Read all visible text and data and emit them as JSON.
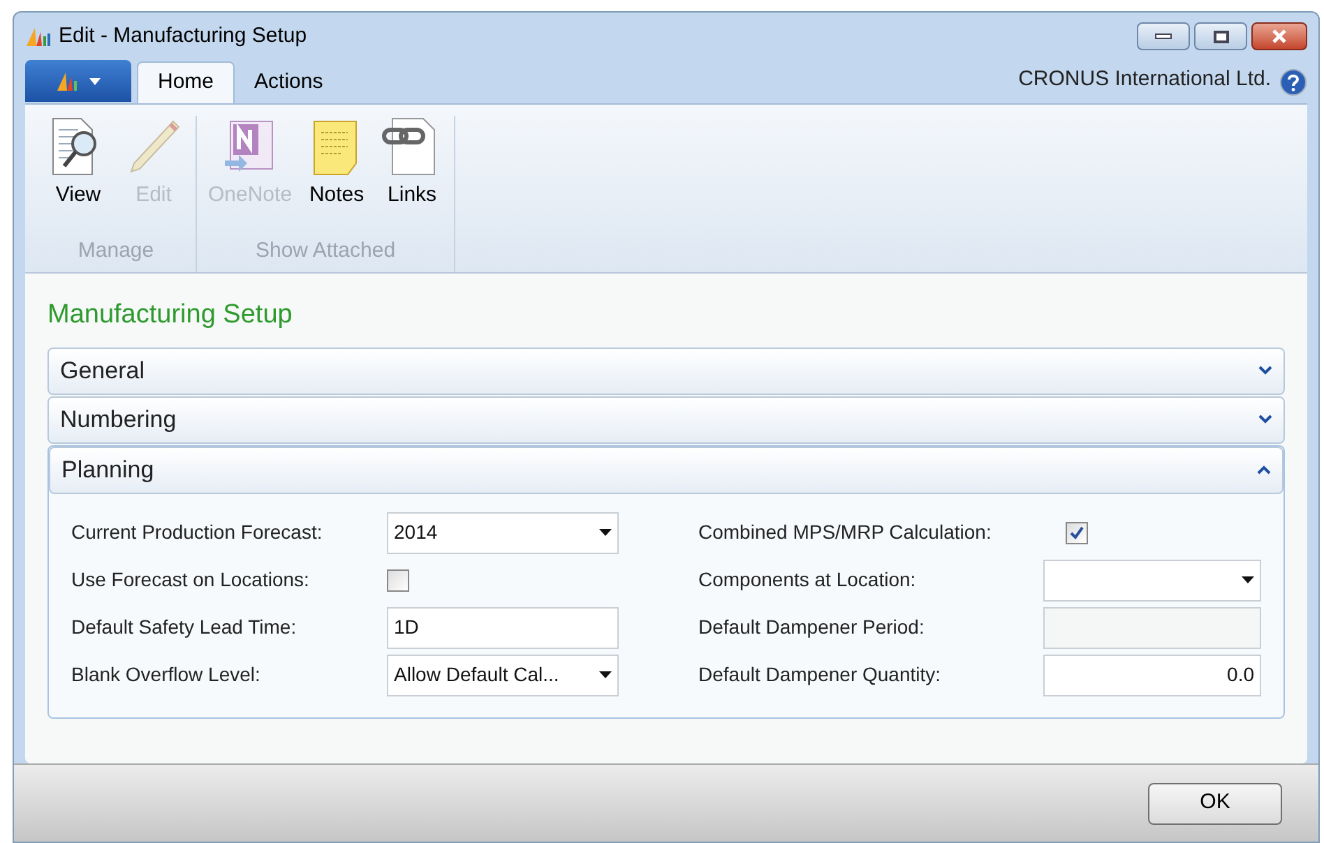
{
  "window": {
    "title": "Edit - Manufacturing Setup"
  },
  "ribbon": {
    "tabs": [
      {
        "label": "Home",
        "selected": true
      },
      {
        "label": "Actions",
        "selected": false
      }
    ],
    "company": "CRONUS International Ltd.",
    "groups": [
      {
        "label": "Manage",
        "buttons": [
          {
            "label": "View",
            "kind": "view",
            "disabled": false
          },
          {
            "label": "Edit",
            "kind": "edit",
            "disabled": true
          }
        ]
      },
      {
        "label": "Show Attached",
        "buttons": [
          {
            "label": "OneNote",
            "kind": "onenote",
            "disabled": true
          },
          {
            "label": "Notes",
            "kind": "notes",
            "disabled": false
          },
          {
            "label": "Links",
            "kind": "links",
            "disabled": false
          }
        ]
      }
    ]
  },
  "page_title": "Manufacturing Setup",
  "sections": [
    {
      "title": "General",
      "expanded": false
    },
    {
      "title": "Numbering",
      "expanded": false
    },
    {
      "title": "Planning",
      "expanded": true,
      "columns": [
        [
          {
            "label": "Current Production Forecast:",
            "kind": "dropdown",
            "value": "2014"
          },
          {
            "label": "Use Forecast on Locations:",
            "kind": "checkbox",
            "checked": false
          },
          {
            "label": "Default Safety Lead Time:",
            "kind": "text",
            "value": "1D"
          },
          {
            "label": "Blank Overflow Level:",
            "kind": "dropdown",
            "value": "Allow Default Cal..."
          }
        ],
        [
          {
            "label": "Combined MPS/MRP Calculation:",
            "kind": "checkbox",
            "checked": true
          },
          {
            "label": "Components at Location:",
            "kind": "dropdown"
          },
          {
            "label": "Default Dampener Period:",
            "kind": "text"
          },
          {
            "label": "Default Dampener Quantity:",
            "kind": "number",
            "value": "0.0"
          }
        ]
      ]
    }
  ],
  "buttons": [
    "OK"
  ]
}
